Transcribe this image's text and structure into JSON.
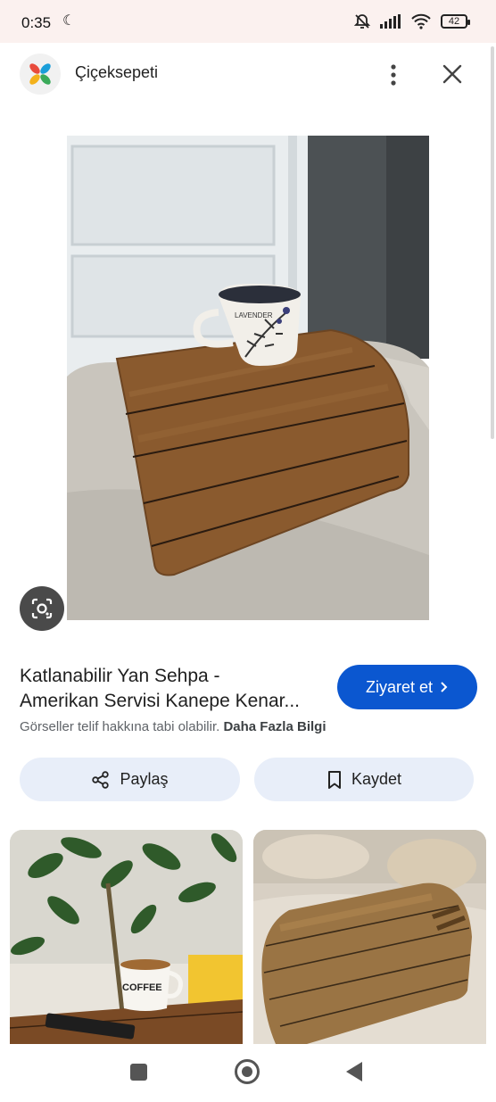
{
  "status_bar": {
    "time": "0:35",
    "battery": "42",
    "icons": [
      "moon-icon",
      "bell-off-icon",
      "signal-icon",
      "wifi-icon",
      "battery-icon"
    ]
  },
  "header": {
    "site_name": "Çiçeksepeti",
    "icons": [
      "site-logo-icon",
      "more-vert-icon",
      "close-icon"
    ]
  },
  "result": {
    "title_line1": "Katlanabilir Yan Sehpa -",
    "title_line2": "Amerikan Servisi Kanepe Kenar...",
    "visit_label": "Ziyaret et",
    "copyright_text": "Görseller telif hakkına tabi olabilir.",
    "more_info": "Daha Fazla Bilgi"
  },
  "actions": {
    "share_label": "Paylaş",
    "save_label": "Kaydet"
  },
  "related": {
    "mug_text": "COFFEE"
  },
  "main_image": {
    "mug_text": "LAVENDER"
  },
  "colors": {
    "accent": "#0b57d0",
    "pill_bg": "#e8eef9",
    "status_bg": "#fbf1ef"
  }
}
